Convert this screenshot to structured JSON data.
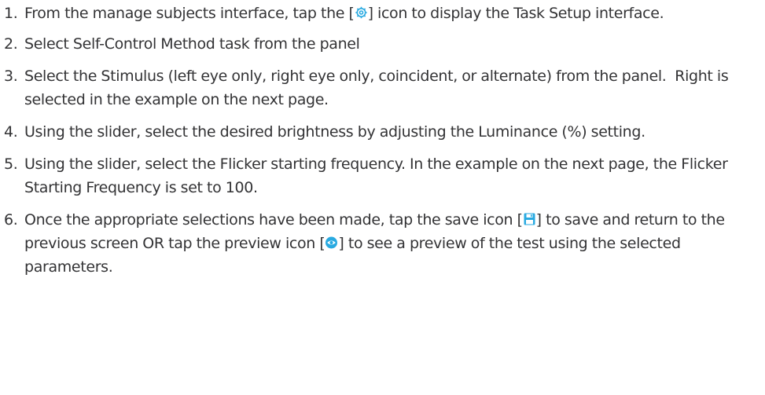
{
  "steps": [
    {
      "number": "1.",
      "segments": [
        {
          "type": "text",
          "value": "From the manage subjects interface, tap the ["
        },
        {
          "type": "icon",
          "name": "gear-icon"
        },
        {
          "type": "text",
          "value": "] icon to display the Task Setup interface."
        }
      ]
    },
    {
      "number": "2.",
      "segments": [
        {
          "type": "text",
          "value": "Select Self-Control Method task from the panel"
        }
      ]
    },
    {
      "number": "3.",
      "segments": [
        {
          "type": "text",
          "value": "Select the Stimulus (left eye only, right eye only, coincident, or alternate) from the panel.  Right is selected in the example on the next page."
        }
      ]
    },
    {
      "number": "4.",
      "segments": [
        {
          "type": "text",
          "value": "Using the slider, select the desired brightness by adjusting the Luminance (%) setting."
        }
      ]
    },
    {
      "number": "5.",
      "segments": [
        {
          "type": "text",
          "value": "Using the slider, select the Flicker starting frequency. In the example on the next page, the Flicker Starting Frequency is set to 100."
        }
      ]
    },
    {
      "number": "6.",
      "segments": [
        {
          "type": "text",
          "value": "Once the appropriate selections have been made, tap the save icon ["
        },
        {
          "type": "icon",
          "name": "save-icon"
        },
        {
          "type": "text",
          "value": "] to save and return to the previous screen OR tap the preview icon ["
        },
        {
          "type": "icon",
          "name": "eye-preview-icon"
        },
        {
          "type": "text",
          "value": "] to see a preview of the test using the selected parameters."
        }
      ]
    }
  ],
  "colors": {
    "text": "#333335",
    "icon_accent": "#29aae1"
  }
}
